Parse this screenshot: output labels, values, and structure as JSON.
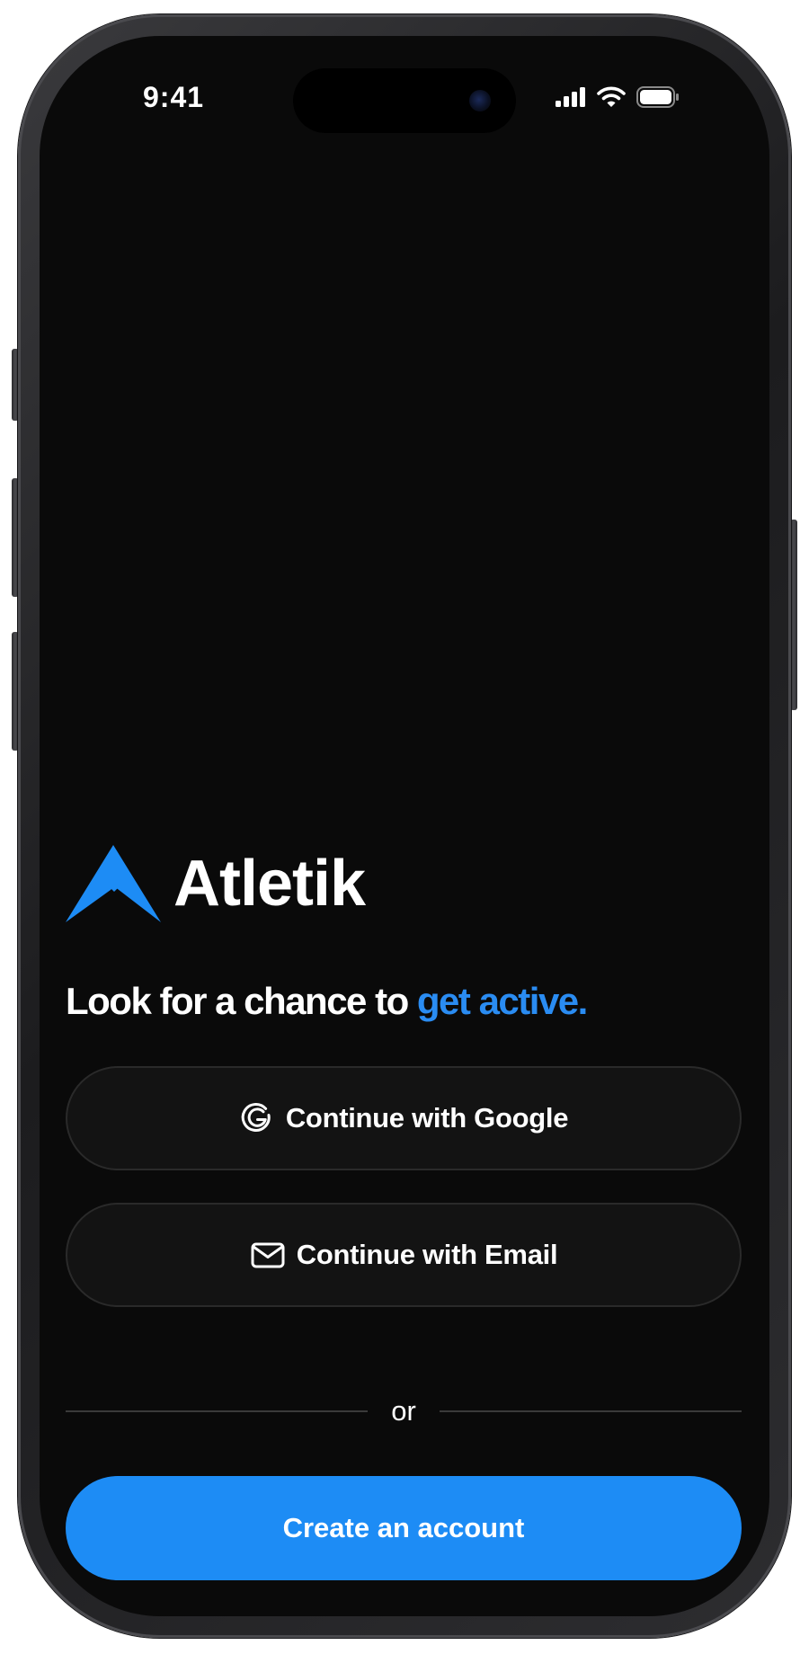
{
  "status_bar": {
    "time": "9:41",
    "icons": [
      "signal-icon",
      "wifi-icon",
      "battery-icon"
    ]
  },
  "brand": {
    "name": "Atletik",
    "logo_icon": "mountain-logo-icon",
    "accent_color": "#1d8cf5"
  },
  "tagline": {
    "lead": "Look for a chance to",
    "highlight": "get active."
  },
  "auth": {
    "google_label": "Continue with Google",
    "google_icon": "google-icon",
    "email_label": "Continue with Email",
    "email_icon": "envelope-icon",
    "divider_text": "or",
    "create_label": "Create an account"
  },
  "colors": {
    "screen_background": "#0a0a0a",
    "pill_background": "#131313",
    "pill_border": "#2a2a2a",
    "primary_button": "#1d8cf5",
    "highlight_text": "#2a8cf2"
  }
}
